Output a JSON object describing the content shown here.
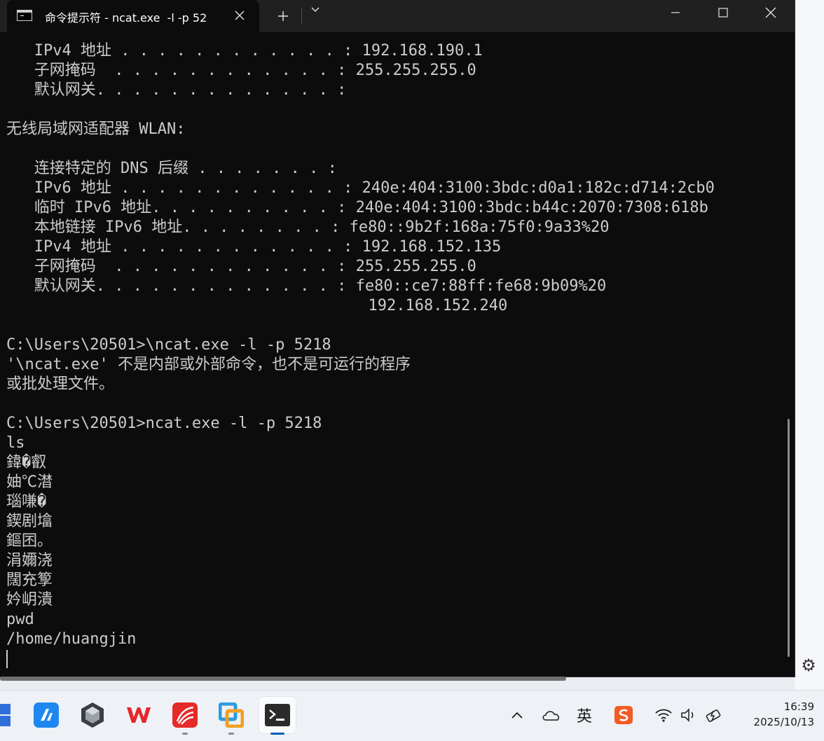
{
  "window": {
    "tab_title": "命令提示符 - ncat.exe  -l -p 52",
    "icons": {
      "tab": "console-icon",
      "close_tab": "close-icon",
      "new_tab": "plus-icon",
      "dropdown": "chevron-down-icon",
      "minimize": "minimize-icon",
      "maximize": "maximize-icon",
      "close": "close-icon"
    }
  },
  "console": {
    "lines": [
      "   IPv4 地址 . . . . . . . . . . . . : 192.168.190.1",
      "   子网掩码  . . . . . . . . . . . . : 255.255.255.0",
      "   默认网关. . . . . . . . . . . . . :",
      "",
      "无线局域网适配器 WLAN:",
      "",
      "   连接特定的 DNS 后缀 . . . . . . . :",
      "   IPv6 地址 . . . . . . . . . . . . : 240e:404:3100:3bdc:d0a1:182c:d714:2cb0",
      "   临时 IPv6 地址. . . . . . . . . . : 240e:404:3100:3bdc:b44c:2070:7308:618b",
      "   本地链接 IPv6 地址. . . . . . . . : fe80::9b2f:168a:75f0:9a33%20",
      "   IPv4 地址 . . . . . . . . . . . . : 192.168.152.135",
      "   子网掩码  . . . . . . . . . . . . : 255.255.255.0",
      "   默认网关. . . . . . . . . . . . . : fe80::ce7:88ff:fe68:9b09%20",
      "                                       192.168.152.240",
      "",
      "C:\\Users\\20501>\\ncat.exe -l -p 5218",
      "'\\ncat.exe' 不是内部或外部命令，也不是可运行的程序",
      "或批处理文件。",
      "",
      "C:\\Users\\20501>ncat.exe -l -p 5218",
      "ls",
      "鍏�叡",
      "妯℃澘",
      "瑙嗛�",
      "鍥剧墖",
      "鏂囨。",
      "涓嬭浇",
      "闊充箰",
      "妗岄潰",
      "pwd",
      "/home/huangjin"
    ]
  },
  "taskbar": {
    "apps": [
      {
        "name": "start-icon"
      },
      {
        "name": "lark-icon"
      },
      {
        "name": "unity-icon"
      },
      {
        "name": "wps-icon"
      },
      {
        "name": "xuexitong-icon"
      },
      {
        "name": "vmware-icon"
      },
      {
        "name": "terminal-icon"
      }
    ],
    "tray": {
      "ime_label": "英",
      "icons": [
        "chevron-up-icon",
        "onedrive-icon",
        "sogou-icon",
        "wifi-icon",
        "volume-icon",
        "battery-icon"
      ]
    },
    "clock": {
      "time": "16:39",
      "date": "2025/10/13"
    }
  },
  "colors": {
    "console_bg": "#0c0c0c",
    "console_fg": "#cccccc",
    "titlebar_bg": "#202020",
    "accent": "#005fb8"
  }
}
